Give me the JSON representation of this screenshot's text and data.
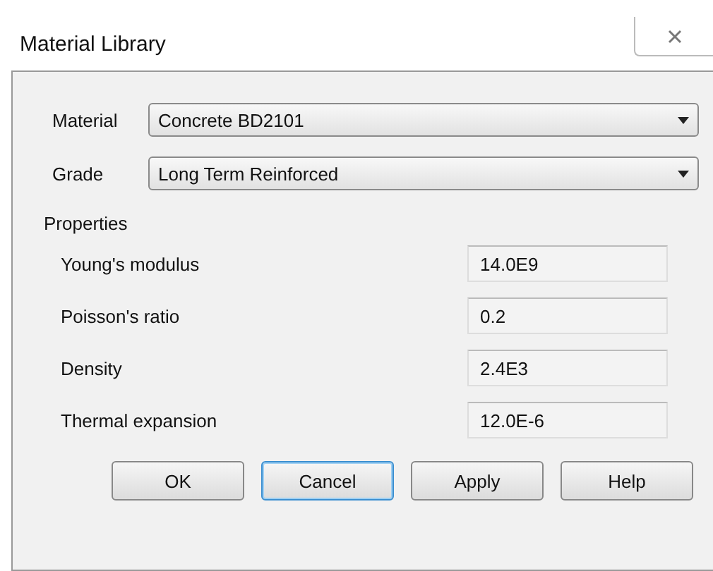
{
  "window": {
    "title": "Material Library"
  },
  "fields": [
    {
      "label": "Material",
      "value": "Concrete BD2101"
    },
    {
      "label": "Grade",
      "value": "Long Term Reinforced"
    }
  ],
  "properties": {
    "title": "Properties",
    "rows": [
      {
        "name": "Young's modulus",
        "value": "14.0E9"
      },
      {
        "name": "Poisson's ratio",
        "value": "0.2"
      },
      {
        "name": "Density",
        "value": "2.4E3"
      },
      {
        "name": "Thermal expansion",
        "value": "12.0E-6"
      }
    ]
  },
  "buttons": [
    {
      "label": "OK",
      "focused": false
    },
    {
      "label": "Cancel",
      "focused": true
    },
    {
      "label": "Apply",
      "focused": false
    },
    {
      "label": "Help",
      "focused": false
    }
  ]
}
